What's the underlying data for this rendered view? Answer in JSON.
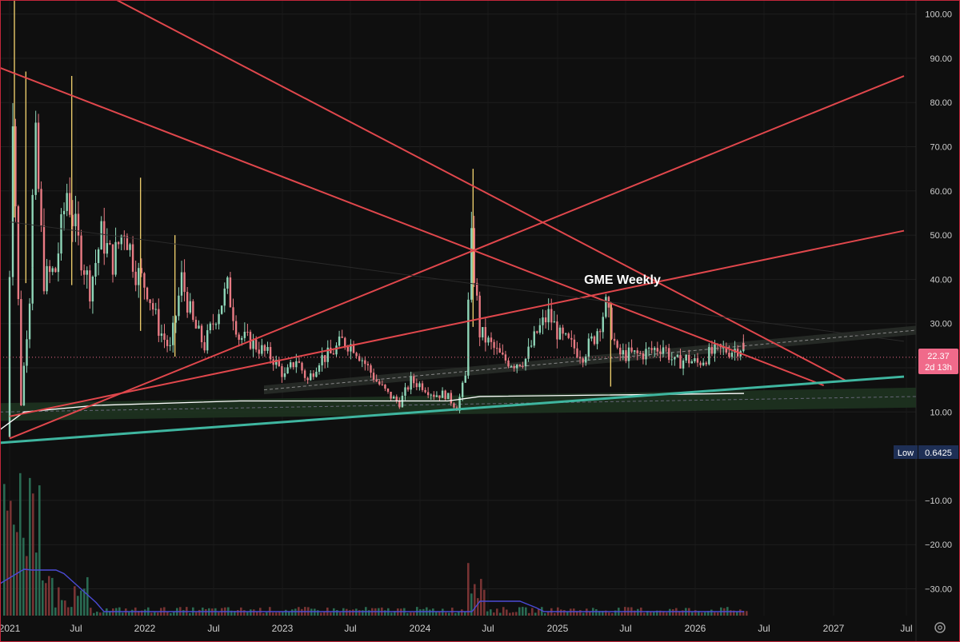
{
  "chart_data": {
    "type": "candlestick",
    "title": "GME Weekly",
    "y_axis": {
      "ticks": [
        "100.00",
        "90.00",
        "80.00",
        "70.00",
        "60.00",
        "50.00",
        "40.00",
        "30.00",
        "20.00",
        "10.00",
        "−10.00",
        "−20.00",
        "−30.00"
      ],
      "range": [
        -36,
        103
      ]
    },
    "x_axis": {
      "ticks": [
        "2021",
        "Jul",
        "2022",
        "Jul",
        "2023",
        "Jul",
        "2024",
        "Jul",
        "2025",
        "Jul",
        "2026",
        "Jul",
        "2027",
        "Jul"
      ]
    },
    "last_price": "22.37",
    "countdown": "2d 13h",
    "low_label": "Low",
    "low_value": "0.6425",
    "price_series": [
      [
        "2021-01",
        4.5
      ],
      [
        "2021-01",
        80
      ],
      [
        "2021-02",
        12
      ],
      [
        "2021-03",
        45
      ],
      [
        "2021-03",
        70
      ],
      [
        "2021-04",
        40
      ],
      [
        "2021-05",
        42
      ],
      [
        "2021-06",
        60
      ],
      [
        "2021-07",
        48
      ],
      [
        "2021-08",
        38
      ],
      [
        "2021-09",
        50
      ],
      [
        "2021-10",
        44
      ],
      [
        "2021-11",
        52
      ],
      [
        "2021-12",
        42
      ],
      [
        "2022-01",
        38
      ],
      [
        "2022-02",
        29
      ],
      [
        "2022-03",
        24
      ],
      [
        "2022-04",
        40
      ],
      [
        "2022-05",
        30
      ],
      [
        "2022-06",
        25
      ],
      [
        "2022-07",
        32
      ],
      [
        "2022-08",
        38
      ],
      [
        "2022-09",
        27
      ],
      [
        "2022-10",
        26
      ],
      [
        "2022-11",
        24
      ],
      [
        "2022-12",
        22
      ],
      [
        "2023-01",
        18
      ],
      [
        "2023-02",
        22
      ],
      [
        "2023-03",
        17
      ],
      [
        "2023-04",
        22
      ],
      [
        "2023-05",
        23
      ],
      [
        "2023-06",
        26
      ],
      [
        "2023-07",
        25
      ],
      [
        "2023-08",
        21
      ],
      [
        "2023-09",
        17
      ],
      [
        "2023-10",
        14
      ],
      [
        "2023-11",
        12
      ],
      [
        "2023-12",
        17
      ],
      [
        "2024-01",
        16
      ],
      [
        "2024-02",
        14
      ],
      [
        "2024-03",
        14
      ],
      [
        "2024-04",
        11
      ],
      [
        "2024-05",
        20
      ],
      [
        "2024-05",
        48
      ],
      [
        "2024-06",
        28
      ],
      [
        "2024-07",
        25
      ],
      [
        "2024-08",
        22
      ],
      [
        "2024-09",
        21
      ],
      [
        "2024-10",
        22
      ],
      [
        "2024-11",
        28
      ],
      [
        "2024-12",
        32
      ],
      [
        "2025-01",
        27
      ],
      [
        "2025-02",
        25
      ],
      [
        "2025-03",
        23
      ],
      [
        "2025-04",
        27
      ],
      [
        "2025-05",
        34
      ],
      [
        "2025-06",
        23
      ],
      [
        "2025-07",
        23
      ],
      [
        "2025-08",
        23
      ],
      [
        "2025-09",
        24
      ],
      [
        "2025-10",
        25
      ],
      [
        "2025-11",
        21
      ],
      [
        "2025-12",
        22
      ],
      [
        "2026-01",
        21
      ],
      [
        "2026-02",
        23
      ],
      [
        "2026-03",
        24
      ],
      [
        "2026-04",
        24
      ],
      [
        "2026-05",
        25
      ],
      [
        "2026-05",
        22.37
      ]
    ],
    "spikes": [
      {
        "date": "2021-01",
        "high": 120
      },
      {
        "date": "2021-02",
        "high": 87
      },
      {
        "date": "2021-06",
        "high": 86
      },
      {
        "date": "2021-12",
        "high": 63
      },
      {
        "date": "2022-03",
        "high": 50
      },
      {
        "date": "2024-05",
        "high": 65
      },
      {
        "date": "2025-05",
        "high": 35
      }
    ],
    "trendlines": [
      {
        "color": "#e0474c",
        "from": [
          "2020-12",
          88
        ],
        "to": [
          "2026-12",
          16
        ]
      },
      {
        "color": "#e0474c",
        "from": [
          "2021-09",
          105
        ],
        "to": [
          "2027-02",
          17
        ]
      },
      {
        "color": "#e0474c",
        "from": [
          "2021-01",
          4
        ],
        "to": [
          "2027-07",
          86
        ]
      },
      {
        "color": "#e0474c",
        "from": [
          "2021-01",
          9
        ],
        "to": [
          "2027-07",
          51
        ]
      },
      {
        "color": "#2a2a2a",
        "from": [
          "2021-01",
          53
        ],
        "to": [
          "2027-07",
          26
        ]
      },
      {
        "color": "#3fb6a0",
        "from": [
          "2020-12",
          3
        ],
        "to": [
          "2027-07",
          18
        ]
      }
    ],
    "moving_average": {
      "color": "#ffffff"
    },
    "volume_average": {
      "color": "#4b4bd6"
    }
  },
  "settings_icon": "gear-icon"
}
